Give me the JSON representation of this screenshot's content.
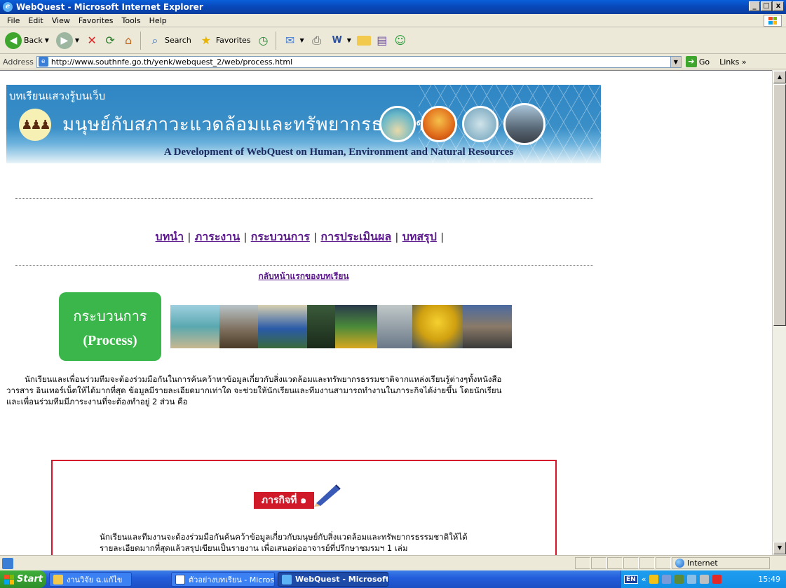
{
  "window": {
    "title": "WebQuest - Microsoft Internet Explorer",
    "controls": [
      "_",
      "□",
      "x"
    ]
  },
  "menu": [
    "File",
    "Edit",
    "View",
    "Favorites",
    "Tools",
    "Help"
  ],
  "toolbar": {
    "back": "Back",
    "search": "Search",
    "favorites": "Favorites"
  },
  "address": {
    "label": "Address",
    "url": "http://www.southnfe.go.th/yenk/webquest_2/web/process.html",
    "go": "Go",
    "links": "Links"
  },
  "page": {
    "banner": {
      "tag": "บทเรียนแสวงรู้บนเว็บ",
      "title": "มนุษย์กับสภาวะแวดล้อมและทรัพยากรธรรมชาติ",
      "subtitle": "A Development of WebQuest on Human, Environment and Natural Resources"
    },
    "nav": [
      "บทนำ",
      "ภาระงาน",
      "กระบวนการ",
      "การประเมินผล",
      "บทสรุป"
    ],
    "home_link": "กลับหน้าแรกของบทเรียน",
    "process_box": {
      "thai": "กระบวนการ",
      "english": "(Process)"
    },
    "intro": [
      "นักเรียนและเพื่อนร่วมทีมจะต้องร่วมมือกันในการค้นคว้าหาข้อมูลเกี่ยวกับสิ่งแวดล้อมและทรัพยากรธรรมชาติจากแหล่งเรียนรู้ต่างๆทั้งหนังสือ",
      "วารสาร อินเทอร์เน็ตให้ได้มากที่สุด ข้อมูลมีรายละเอียดมากเท่าใด จะช่วยให้นักเรียนและทีมงานสามารถทำงานในภาระกิจได้ง่ายขึ้น โดยนักเรียน",
      "และเพื่อนร่วมทีมมีภาระงานที่จะต้องทำอยู่ 2 ส่วน คือ"
    ],
    "task1": {
      "badge": "ภารกิจที่ ๑",
      "lines": [
        "นักเรียนและทีมงานจะต้องร่วมมือกันค้นคว้าข้อมูลเกี่ยวกับมนุษย์กับสิ่งแวดล้อมและทรัพยากรธรรมชาติให้ได้",
        "รายละเอียดมากที่สุดแล้วสรุปเขียนเป็นรายงาน เพื่อเสนอต่ออาจารย์ที่ปรึกษาชมรมฯ 1 เล่ม"
      ]
    }
  },
  "status": {
    "zone": "Internet"
  },
  "taskbar": {
    "start": "Start",
    "tasks": [
      "งานวิจัย ฉ.แก้ไข",
      "ตัวอย่างบทเรียน - Microso...",
      "WebQuest - Microsoft..."
    ],
    "lang": "EN",
    "clock": "15:49"
  }
}
